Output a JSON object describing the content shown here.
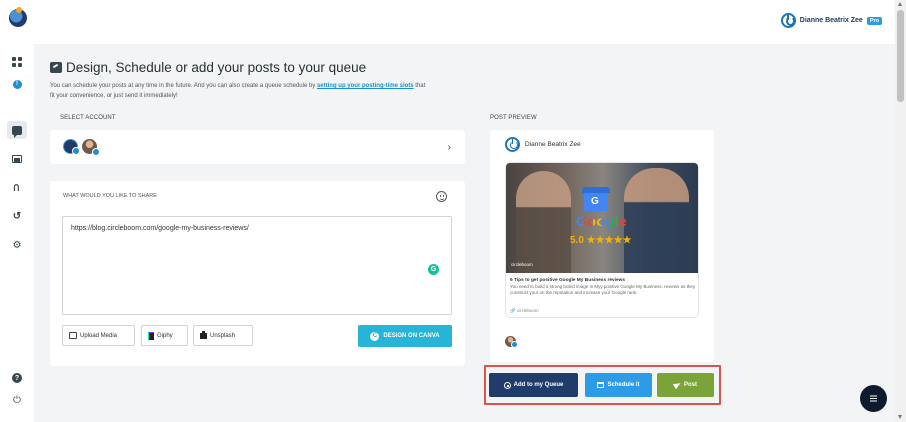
{
  "header": {
    "user_name": "Dianne Beatrix Zee",
    "badge": "Pro"
  },
  "page": {
    "title": "Design, Schedule or add your posts to your queue",
    "subtitle_start": "You can schedule your posts at any time in the future. And you can also create a queue schedule by ",
    "subtitle_link": "setting up your posting-time slots",
    "subtitle_end": " that fit your convenience, or just send it immediately!"
  },
  "select_account": {
    "label": "SELECT ACCOUNT",
    "chevron": "›"
  },
  "share": {
    "label": "WHAT WOULD YOU LIKE TO SHARE",
    "text_value": "https://blog.circleboom.com/google-my-business-reviews/",
    "grammarly": "G",
    "upload_label": "Upload Media",
    "giphy_label": "Giphy",
    "unsplash_label": "Unsplash",
    "canva_label": "DESIGN ON CANVA",
    "canva_icon_letter": "C"
  },
  "preview": {
    "label": "POST PREVIEW",
    "user_name": "Dianne Beatrix Zee",
    "image_word": "Google",
    "image_rating": "5.0 ★★★★★",
    "image_brand": "circleboom",
    "headline": "5 Tips to get positive Google My Business reviews",
    "description": "You need to build a strong brand image in Myy positive Google My Business. reviews as they construct your on the reputation and increase your Google rank.",
    "link": "🔗 circleboom"
  },
  "actions": {
    "queue_label": "Add to my Queue",
    "schedule_label": "Schedule it",
    "post_label": "Post"
  },
  "sidebar": {
    "info_icon_text": "!",
    "rss_icon": "⊃",
    "history_icon": "↺",
    "settings_icon": "⚙",
    "help_icon": "?",
    "power_icon": "⏻"
  },
  "colors": {
    "queue": "#1f3c6b",
    "schedule": "#2d9ce8",
    "post": "#7aa33a",
    "canva": "#26b5d6",
    "highlight": "#d9534f"
  }
}
